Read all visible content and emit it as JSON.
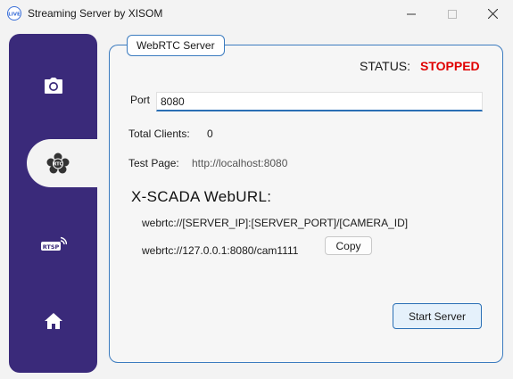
{
  "window": {
    "title": "Streaming Server by XISOM",
    "app_icon_text": "LIVE"
  },
  "sidebar": {
    "items": [
      {
        "id": "camera",
        "icon": "camera-icon",
        "selected": false
      },
      {
        "id": "webrtc",
        "icon": "webrtc-icon",
        "icon_text": "RTC",
        "selected": true
      },
      {
        "id": "rtsp",
        "icon": "rtsp-icon",
        "icon_text": "RTSP",
        "selected": false
      },
      {
        "id": "home",
        "icon": "home-icon",
        "selected": false
      }
    ]
  },
  "panel": {
    "legend": "WebRTC Server",
    "status_label": "STATUS:",
    "status_value": "STOPPED",
    "port_label": "Port",
    "port_value": "8080",
    "clients_label": "Total Clients:",
    "clients_value": "0",
    "testpage_label": "Test Page:",
    "testpage_value": "http://localhost:8080",
    "weburl_title": "X-SCADA WebURL:",
    "url_template": "webrtc://[SERVER_IP]:[SERVER_PORT]/[CAMERA_ID]",
    "url_example": "webrtc://127.0.0.1:8080/cam1111",
    "copy_label": "Copy",
    "start_label": "Start Server"
  },
  "colors": {
    "sidebar_bg": "#3a2a7a",
    "accent_border": "#3b7bbf",
    "status_stopped": "#e00000",
    "start_button_bg": "#e5f1fb"
  }
}
